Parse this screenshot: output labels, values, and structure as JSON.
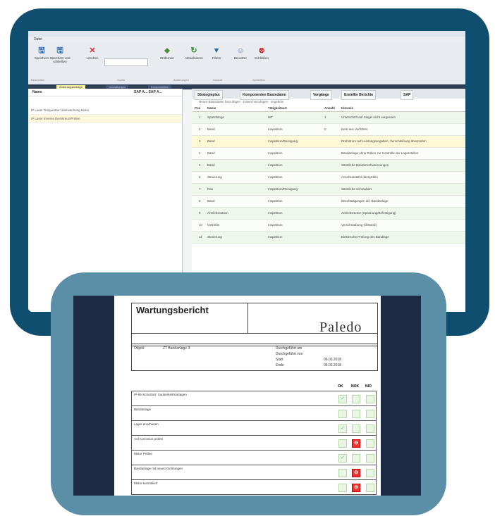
{
  "app": {
    "title": "",
    "menu": "Datei",
    "ribbon": [
      {
        "label": "Speichern",
        "icon": "save-icon",
        "glyph": "🖫",
        "color": "#2f6fb5"
      },
      {
        "label": "Speichern und schließen",
        "icon": "save-close-icon",
        "glyph": "🖫",
        "color": "#2f6fb5"
      },
      {
        "label": "Löschen",
        "icon": "delete-icon",
        "glyph": "✕",
        "color": "#e0262f"
      },
      {
        "label": "Entfernen",
        "icon": "remove-icon",
        "glyph": "⬥",
        "color": "#4a8f3b"
      },
      {
        "label": "Aktualisieren",
        "icon": "refresh-icon",
        "glyph": "↻",
        "color": "#2d8a2d"
      },
      {
        "label": "Filtern",
        "icon": "filter-icon",
        "glyph": "▼",
        "color": "#2d6a9a"
      },
      {
        "label": "Benutzer",
        "icon": "users-icon",
        "glyph": "☺",
        "color": "#6b7bb5"
      },
      {
        "label": "Schließen",
        "icon": "close-icon",
        "glyph": "⊗",
        "color": "#d42a2a"
      }
    ],
    "ribbon_groups": [
      "Bearbeiten",
      "Suche",
      "Änderungen",
      "Ansicht",
      "Schließen"
    ],
    "tabs": [
      "Änderungsanträge",
      "Verwaltungen",
      "Komponenten"
    ],
    "left": {
      "header_name": "Name",
      "header_cols": "SAP A...  SAP A...",
      "rows": [
        "IP Laser Temperatur Überwachung Motor",
        "IP Laser Inneres Drehkreuz/Prüfen"
      ]
    },
    "right_tabs": [
      "Strategieplan",
      "Komponenten Basisdaten",
      "Vorgänge",
      "Erstellte Berichte",
      "SAP"
    ],
    "toolbar": "Neuer Basisdaten hinzufügen  ·  Daten hinzufügen  ·  Ergebnis",
    "grid_headers": [
      "Pos",
      "Name",
      "Tätigkeitsart",
      "Anzahl",
      "Hinweis"
    ],
    "grid_rows": [
      [
        "1",
        "Spannlänge",
        "WT",
        "1",
        "Unterschrift auf Siegel nicht vergessen"
      ],
      [
        "2",
        "Band",
        "Inspektion",
        "0",
        "Nein aus Vorführer"
      ],
      [
        "3",
        "Band",
        "Inspektion/Reinigung",
        "",
        "Drehstrom auf Leistungsangaben, Verschleißung überprüfen"
      ],
      [
        "4",
        "Band",
        "Inspektion",
        "",
        "Bandanlage ohne Rollen zur Kontrolle der Lagerstellen"
      ],
      [
        "5",
        "Band",
        "Inspektion",
        "",
        "Sämtliche Bandanschweissungen"
      ],
      [
        "6",
        "Steuerung",
        "Inspektion",
        "",
        "Anschlusstafel überprüfen"
      ],
      [
        "7",
        "Rau",
        "Inspektion/Reinigung",
        "",
        "Sämtliche Schrauben"
      ],
      [
        "8",
        "Band",
        "Inspektion",
        "",
        "Beschädigungen der Bandanlage"
      ],
      [
        "9",
        "Antriebsstation",
        "Inspektion",
        "",
        "Antriebsmotor (Spannung/Befestigung)"
      ],
      [
        "10",
        "Getriebe",
        "Inspektion",
        "",
        "Verschraubung (Ölstand)"
      ],
      [
        "11",
        "Steuerung",
        "Inspektion",
        "",
        "Elektrische Prüfung des Bandlage"
      ]
    ]
  },
  "report": {
    "title": "Wartungsbericht",
    "logo": "aledo",
    "logo_initial": "P",
    "logo_tagline": "",
    "info_labels": [
      "Objekt",
      "Durchgeführt am",
      "Durchgeführt von",
      "Start",
      "Ende"
    ],
    "object_value": "ZT Bandanlage 3",
    "start": "06.03.2018",
    "end": "06.03.2018",
    "col_headers": [
      "OK",
      "NOK",
      "NIO"
    ],
    "checklist": [
      {
        "label": "IP-65-Schutzart: Sauberkeit/Kartagen",
        "state": "ok"
      },
      {
        "label": "Bandanlage",
        "state": "none"
      },
      {
        "label": "Lager anschauen",
        "state": "ok"
      },
      {
        "label": "Auf Korrosion prüfen",
        "state": "nok"
      },
      {
        "label": "Motor Prüfen",
        "state": "ok"
      },
      {
        "label": "Bandanlage mit neuen Dichtungen",
        "state": "nok"
      },
      {
        "label": "Motor kontrolliert",
        "state": "nok"
      }
    ]
  }
}
